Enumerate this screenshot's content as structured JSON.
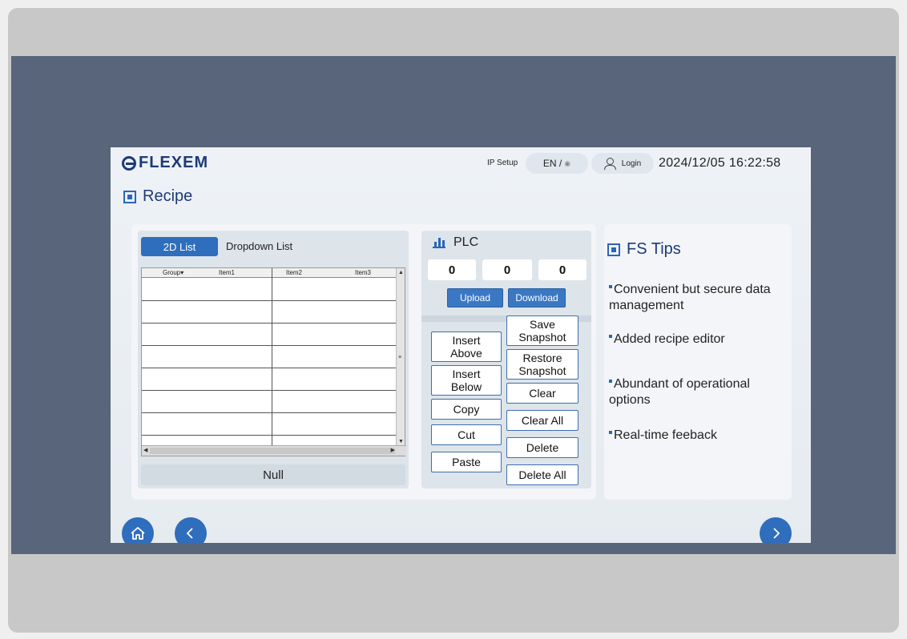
{
  "header": {
    "logo": "FLEXEM",
    "ip_setup": "IP Setup",
    "language": "EN /",
    "login": "Login",
    "datetime": "2024/12/05 16:22:58"
  },
  "page": {
    "title": "Recipe"
  },
  "recipe": {
    "tabs": [
      "2D List",
      "Dropdown List"
    ],
    "table": {
      "columns": [
        "Group▾",
        "Item1",
        "Item2",
        "Item3"
      ]
    },
    "status": "Null"
  },
  "plc": {
    "title": "PLC",
    "values": [
      "0",
      "0",
      "0"
    ],
    "upload": "Upload",
    "download": "Download",
    "buttons": {
      "insert_above": "Insert\nAbove",
      "insert_below": "Insert\nBelow",
      "copy": "Copy",
      "cut": "Cut",
      "paste": "Paste",
      "save_snapshot": "Save\nSnapshot",
      "restore_snapshot": "Restore\nSnapshot",
      "clear": "Clear",
      "clear_all": "Clear All",
      "delete": "Delete",
      "delete_all": "Delete All"
    }
  },
  "tips": {
    "title": "FS Tips",
    "items": [
      "Convenient but secure data management",
      "Added recipe editor",
      "Abundant of operational options",
      "Real-time feeback"
    ]
  },
  "icons": {
    "home": "home-icon",
    "back": "chevron-left-icon",
    "next": "chevron-right-icon",
    "user": "user-icon",
    "globe": "globe-icon",
    "chart": "bar-chart-icon",
    "section": "square-section-icon"
  },
  "colors": {
    "accent": "#2f6dbd",
    "bezel": "#58657b",
    "brand": "#1d3a78"
  }
}
